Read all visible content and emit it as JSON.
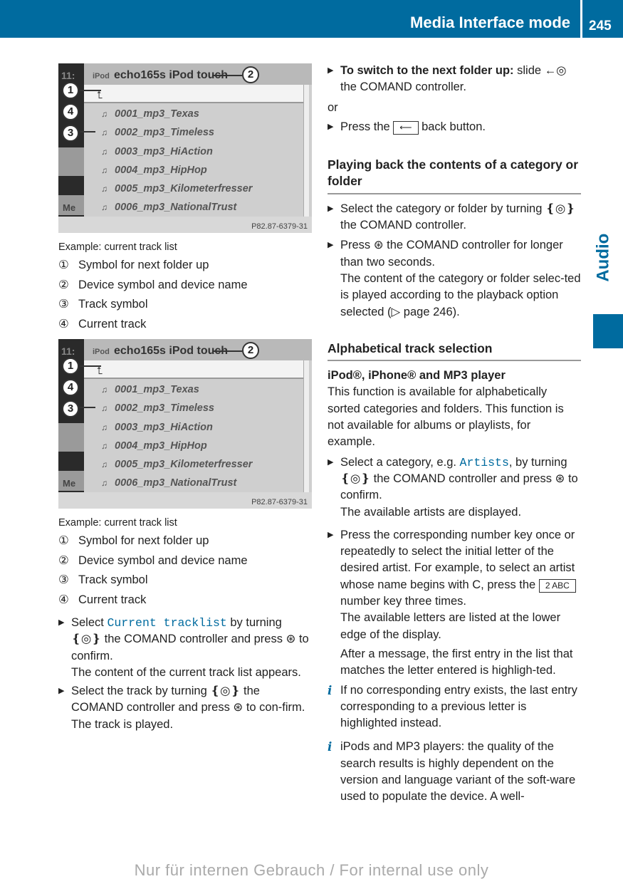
{
  "header": {
    "title": "Media Interface mode",
    "page": "245",
    "accent": "#006b9f"
  },
  "side_tab": "Audio",
  "figures": [
    {
      "device": "echo165s iPod touch",
      "device_icon": "iPod",
      "clock": "11:",
      "side_label": "Me",
      "tracks": [
        "0001_mp3_Texas",
        "0002_mp3_Timeless",
        "0003_mp3_HiAction",
        "0004_mp3_HipHop",
        "0005_mp3_Kilometerfresser",
        "0006_mp3_NationalTrust"
      ],
      "code": "P82.87-6379-31",
      "caption": "Example: current track list",
      "legend": [
        {
          "n": "①",
          "t": "Symbol for next folder up"
        },
        {
          "n": "②",
          "t": "Device symbol and device name"
        },
        {
          "n": "③",
          "t": "Track symbol"
        },
        {
          "n": "④",
          "t": "Current track"
        }
      ]
    },
    {
      "device": "echo165s iPod touch",
      "device_icon": "iPod",
      "clock": "11:",
      "side_label": "Me",
      "tracks": [
        "0001_mp3_Texas",
        "0002_mp3_Timeless",
        "0003_mp3_HiAction",
        "0004_mp3_HipHop",
        "0005_mp3_Kilometerfresser",
        "0006_mp3_NationalTrust"
      ],
      "code": "P82.87-6379-31",
      "caption": "Example: current track list",
      "legend": [
        {
          "n": "①",
          "t": "Symbol for next folder up"
        },
        {
          "n": "②",
          "t": "Device symbol and device name"
        },
        {
          "n": "③",
          "t": "Track symbol"
        },
        {
          "n": "④",
          "t": "Current track"
        }
      ]
    }
  ],
  "callouts": [
    "1",
    "2",
    "3",
    "4"
  ],
  "left_steps": {
    "s1a": "Select ",
    "s1m": "Current tracklist",
    "s1b": " by turning ❴◎❵ the COMAND controller and press ⊛ to confirm.",
    "s1r": "The content of the current track list appears.",
    "s2": "Select the track by turning ❴◎❵ the COMAND controller and press ⊛ to con-firm.",
    "s2r": "The track is played."
  },
  "right": {
    "s1b": "To switch to the next folder up:",
    "s1": " slide ←◎ the COMAND controller.",
    "or": "or",
    "s2a": "Press the ",
    "s2key": "⟵",
    "s2b": " back button.",
    "h1": "Playing back the contents of a category or folder",
    "s3": "Select the category or folder by turning ❴◎❵ the COMAND controller.",
    "s4": "Press ⊛ the COMAND controller for longer than two seconds.",
    "s4r": "The content of the category or folder selec-ted is played according to the playback option selected (▷ page 246).",
    "h2": "Alphabetical track selection",
    "sub": "iPod®, iPhone® and MP3 player",
    "p1": "This function is available for alphabetically sorted categories and folders. This function is not available for albums or playlists, for example.",
    "s5a": "Select a category, e.g. ",
    "s5m": "Artists",
    "s5b": ", by turning ❴◎❵ the COMAND controller and press ⊛ to confirm.",
    "s5r": "The available artists are displayed.",
    "s6a": "Press the corresponding number key once or repeatedly to select the initial letter of the desired artist. For example, to select an artist whose name begins with C, press the ",
    "s6key": "2 ABC",
    "s6b": " number key three times.",
    "s6r1": "The available letters are listed at the lower edge of the display.",
    "s6r2": "After a message, the first entry in the list that matches the letter entered is highligh-ted.",
    "i1": "If no corresponding entry exists, the last entry corresponding to a previous letter is highlighted instead.",
    "i2": "iPods and MP3 players: the quality of the search results is highly dependent on the version and language variant of the soft-ware used to populate the device. A well-"
  },
  "watermark": "Nur für internen Gebrauch / For internal use only"
}
